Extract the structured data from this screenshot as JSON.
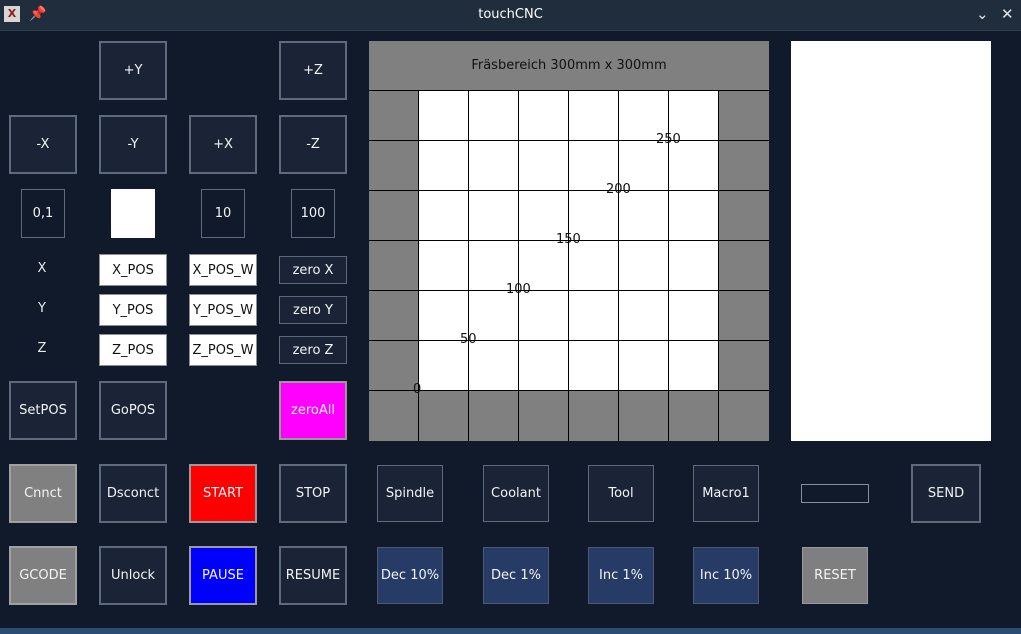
{
  "window": {
    "title": "touchCNC"
  },
  "titlebar": {
    "app_icon": "X",
    "pin_icon": "pin-icon",
    "chevron_icon": "chevron-down-icon",
    "close_icon": "close-icon"
  },
  "jog": {
    "plus_y": "+Y",
    "plus_z": "+Z",
    "minus_x": "-X",
    "minus_y": "-Y",
    "plus_x": "+X",
    "minus_z": "-Z"
  },
  "steps": {
    "s0_1": "0,1",
    "s1": "",
    "s10": "10",
    "s100": "100"
  },
  "axes": {
    "x": {
      "label": "X",
      "pos": "X_POS",
      "pos_w": "X_POS_W",
      "zero": "zero X"
    },
    "y": {
      "label": "Y",
      "pos": "Y_POS",
      "pos_w": "Y_POS_W",
      "zero": "zero Y"
    },
    "z": {
      "label": "Z",
      "pos": "Z_POS",
      "pos_w": "Z_POS_W",
      "zero": "zero Z"
    }
  },
  "actions": {
    "setpos": "SetPOS",
    "gopos": "GoPOS",
    "zeroall": "zeroAll"
  },
  "plot": {
    "title": "Fräsbereich 300mm x 300mm",
    "ticks": [
      "0",
      "50",
      "100",
      "150",
      "200",
      "250"
    ]
  },
  "row1": {
    "connect": "Cnnct",
    "disconnect": "Dsconct",
    "start": "START",
    "stop": "STOP",
    "spindle": "Spindle",
    "coolant": "Coolant",
    "tool": "Tool",
    "macro1": "Macro1",
    "send": "SEND",
    "command_value": ""
  },
  "row2": {
    "gcode": "GCODE",
    "unlock": "Unlock",
    "pause": "PAUSE",
    "resume": "RESUME",
    "dec10": "Dec 10%",
    "dec1": "Dec 1%",
    "inc1": "Inc 1%",
    "inc10": "Inc 10%",
    "reset": "RESET"
  },
  "colors": {
    "background": "#111a2b",
    "start": "#ff0000",
    "pause": "#0000ff",
    "zeroall": "#ff00ff",
    "override": "#263c67",
    "grey": "#808080"
  }
}
